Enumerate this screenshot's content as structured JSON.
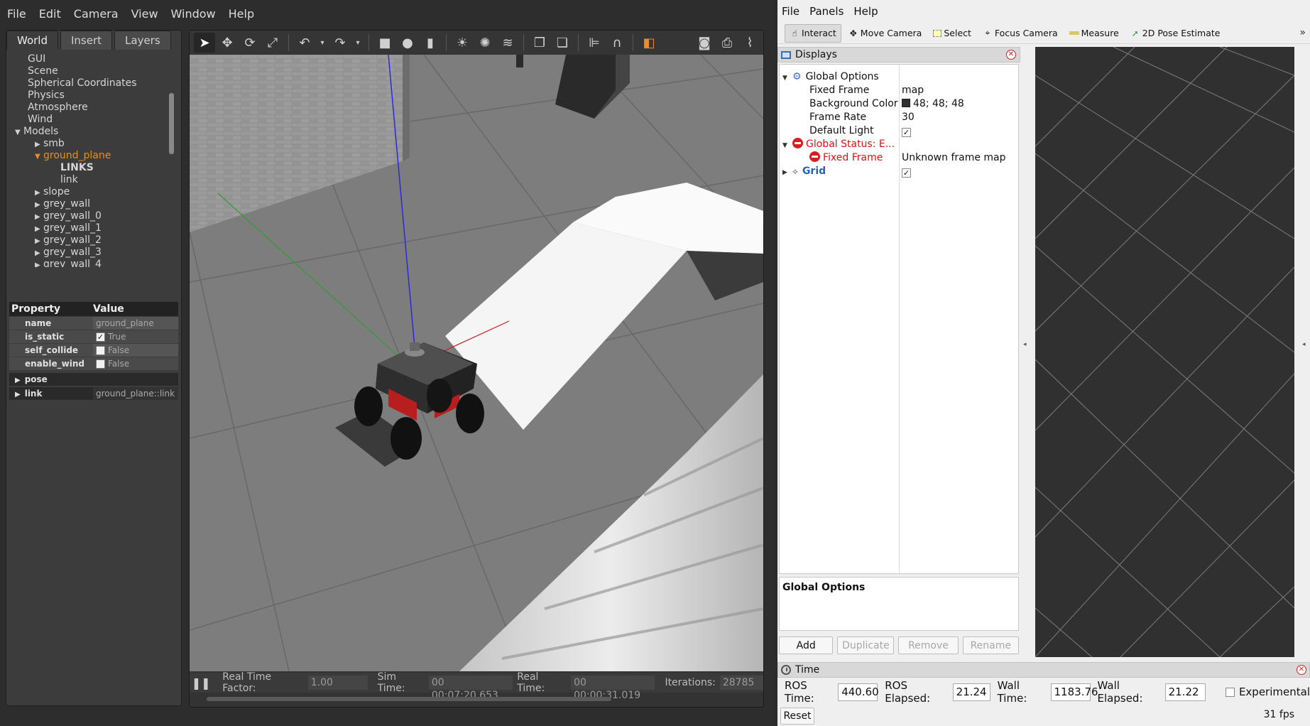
{
  "gazebo": {
    "menu": [
      "File",
      "Edit",
      "Camera",
      "View",
      "Window",
      "Help"
    ],
    "tabs": [
      "World",
      "Insert",
      "Layers"
    ],
    "tree": {
      "gui": "GUI",
      "scene": "Scene",
      "spherical": "Spherical Coordinates",
      "physics": "Physics",
      "atmosphere": "Atmosphere",
      "wind": "Wind",
      "models": "Models",
      "smb": "smb",
      "ground_plane": "ground_plane",
      "links": "LINKS",
      "link": "link",
      "slope": "slope",
      "w0": "grey_wall",
      "w1": "grey_wall_0",
      "w2": "grey_wall_1",
      "w3": "grey_wall_2",
      "w4": "grey_wall_3",
      "w5": "grey_wall_4"
    },
    "props": {
      "header_property": "Property",
      "header_value": "Value",
      "name_key": "name",
      "name_val": "ground_plane",
      "static_key": "is_static",
      "static_val": "True",
      "collide_key": "self_collide",
      "collide_val": "False",
      "wind_key": "enable_wind",
      "wind_val": "False",
      "pose_key": "pose",
      "link_key": "link",
      "link_val": "ground_plane::link"
    },
    "status": {
      "rtf_label": "Real Time Factor:",
      "rtf": "1.00",
      "sim_label": "Sim Time:",
      "sim": "00 00:07:20.653",
      "real_label": "Real Time:",
      "real": "00 00:00:31.019",
      "iter_label": "Iterations:",
      "iter": "28785"
    }
  },
  "rviz": {
    "menu": [
      "File",
      "Panels",
      "Help"
    ],
    "tools": [
      "Interact",
      "Move Camera",
      "Select",
      "Focus Camera",
      "Measure",
      "2D Pose Estimate"
    ],
    "displays_title": "Displays",
    "tree": {
      "global_options": "Global Options",
      "fixed_frame": "Fixed Frame",
      "fixed_frame_val": "map",
      "bg_color": "Background Color",
      "bg_color_val": "48; 48; 48",
      "frame_rate": "Frame Rate",
      "frame_rate_val": "30",
      "default_light": "Default Light",
      "global_status": "Global Status: E...",
      "status_fixed_frame": "Fixed Frame",
      "status_fixed_frame_val": "Unknown frame map",
      "grid": "Grid"
    },
    "desc_title": "Global Options",
    "buttons": [
      "Add",
      "Duplicate",
      "Remove",
      "Rename"
    ],
    "time": {
      "title": "Time",
      "ros_time_label": "ROS Time:",
      "ros_time": "440.60",
      "ros_elapsed_label": "ROS Elapsed:",
      "ros_elapsed": "21.24",
      "wall_time_label": "Wall Time:",
      "wall_time": "1183.76",
      "wall_elapsed_label": "Wall Elapsed:",
      "wall_elapsed": "21.22",
      "experimental": "Experimental",
      "reset": "Reset",
      "fps": "31 fps"
    },
    "colors": {
      "background": "#303030",
      "grid": "#a0a0a0",
      "error": "#d11111"
    }
  }
}
